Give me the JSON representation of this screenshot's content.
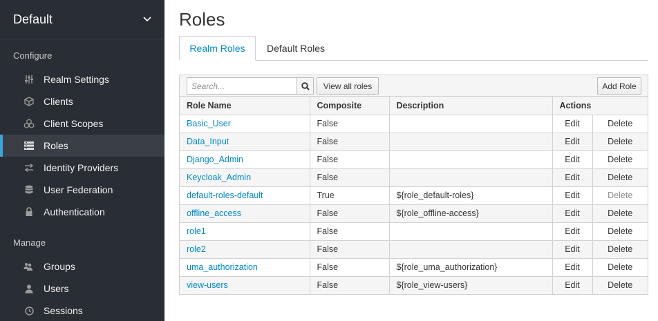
{
  "sidebar": {
    "realm": "Default",
    "configure_label": "Configure",
    "manage_label": "Manage",
    "configure_items": [
      {
        "label": "Realm Settings",
        "icon": "sliders-icon"
      },
      {
        "label": "Clients",
        "icon": "cube-icon"
      },
      {
        "label": "Client Scopes",
        "icon": "cubes-icon"
      },
      {
        "label": "Roles",
        "icon": "list-icon",
        "active": true
      },
      {
        "label": "Identity Providers",
        "icon": "exchange-icon"
      },
      {
        "label": "User Federation",
        "icon": "database-icon"
      },
      {
        "label": "Authentication",
        "icon": "lock-icon"
      }
    ],
    "manage_items": [
      {
        "label": "Groups",
        "icon": "users-icon"
      },
      {
        "label": "Users",
        "icon": "user-icon"
      },
      {
        "label": "Sessions",
        "icon": "clock-icon"
      }
    ]
  },
  "main": {
    "title": "Roles",
    "tabs": [
      {
        "label": "Realm Roles",
        "active": true
      },
      {
        "label": "Default Roles",
        "active": false
      }
    ],
    "toolbar": {
      "search_placeholder": "Search...",
      "view_all_label": "View all roles",
      "add_role_label": "Add Role"
    },
    "columns": [
      "Role Name",
      "Composite",
      "Description",
      "Actions"
    ],
    "edit_label": "Edit",
    "delete_label": "Delete",
    "rows": [
      {
        "name": "Basic_User",
        "composite": "False",
        "description": "",
        "delete_enabled": true
      },
      {
        "name": "Data_Input",
        "composite": "False",
        "description": "",
        "delete_enabled": true
      },
      {
        "name": "Django_Admin",
        "composite": "False",
        "description": "",
        "delete_enabled": true
      },
      {
        "name": "Keycloak_Admin",
        "composite": "False",
        "description": "",
        "delete_enabled": true
      },
      {
        "name": "default-roles-default",
        "composite": "True",
        "description": "${role_default-roles}",
        "delete_enabled": false
      },
      {
        "name": "offline_access",
        "composite": "False",
        "description": "${role_offline-access}",
        "delete_enabled": true
      },
      {
        "name": "role1",
        "composite": "False",
        "description": "",
        "delete_enabled": true
      },
      {
        "name": "role2",
        "composite": "False",
        "description": "",
        "delete_enabled": true
      },
      {
        "name": "uma_authorization",
        "composite": "False",
        "description": "${role_uma_authorization}",
        "delete_enabled": true
      },
      {
        "name": "view-users",
        "composite": "False",
        "description": "${role_view-users}",
        "delete_enabled": true
      }
    ]
  },
  "colors": {
    "sidebar_bg": "#292e34",
    "active_bg": "#393f44",
    "accent": "#39a5dc",
    "link": "#0088ce"
  }
}
